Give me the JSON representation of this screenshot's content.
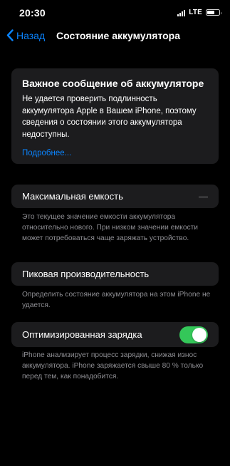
{
  "status_bar": {
    "time": "20:30",
    "network": "LTE",
    "battery_level": 0.62
  },
  "nav": {
    "back_label": "Назад",
    "title": "Состояние аккумулятора"
  },
  "warning": {
    "title": "Важное сообщение об аккумуляторе",
    "body": "Не удается проверить подлинность аккумулятора Apple в Вашем iPhone, поэтому сведения о состоянии этого аккумулятора недоступны.",
    "link": "Подробнее..."
  },
  "max_capacity": {
    "label": "Максимальная емкость",
    "value": "—",
    "footnote": "Это текущее значение емкости аккумулятора относительно нового. При низком значении емкости может потребоваться чаще заряжать устройство."
  },
  "peak_performance": {
    "label": "Пиковая производительность",
    "footnote": "Определить состояние аккумулятора на этом iPhone не удается."
  },
  "optimized_charging": {
    "label": "Оптимизированная зарядка",
    "enabled": true,
    "footnote": "iPhone анализирует процесс зарядки, снижая износ аккумулятора. iPhone заряжается свыше 80 % только перед тем, как понадобится."
  },
  "colors": {
    "accent": "#0a84ff",
    "toggle_on": "#34c759",
    "card_bg": "#1c1c1e",
    "secondary_text": "#8e8e93"
  }
}
